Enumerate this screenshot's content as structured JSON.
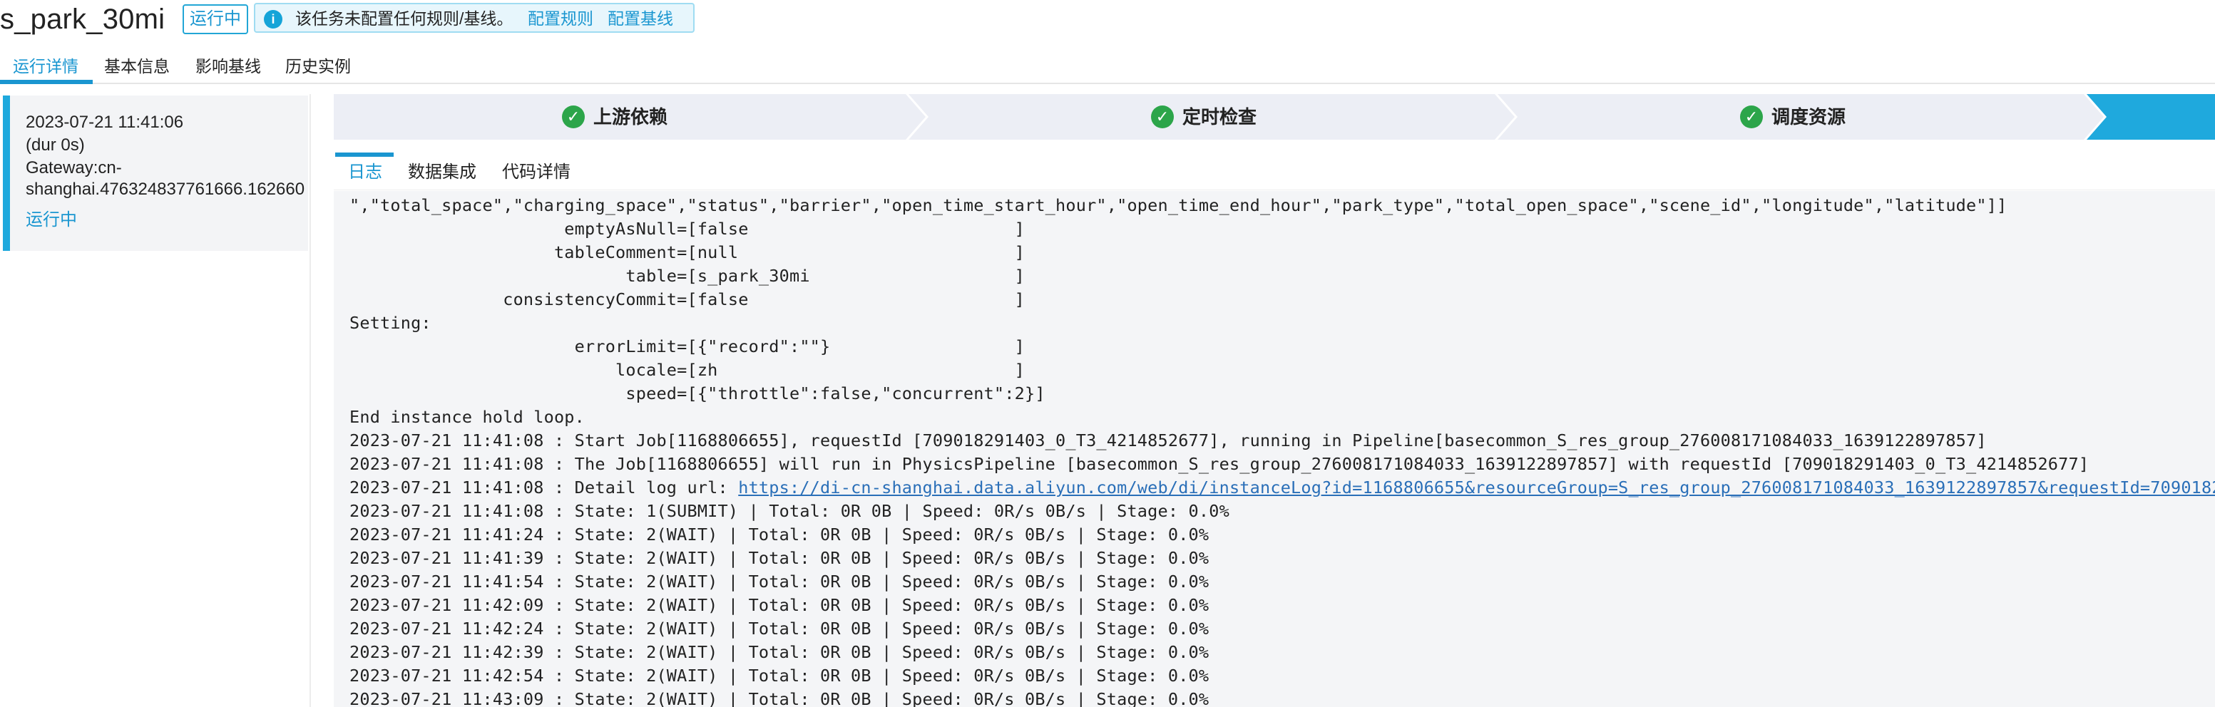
{
  "header": {
    "title": "s_park_30mi",
    "status": "运行中",
    "notice": {
      "icon": "info-icon",
      "text": "该任务未配置任何规则/基线。",
      "link_rules": "配置规则",
      "link_baseline": "配置基线"
    }
  },
  "main_tabs": [
    {
      "label": "运行详情",
      "active": true
    },
    {
      "label": "基本信息",
      "active": false
    },
    {
      "label": "影响基线",
      "active": false
    },
    {
      "label": "历史实例",
      "active": false
    }
  ],
  "instance": {
    "time": "2023-07-21 11:41:06",
    "duration": "(dur 0s)",
    "gateway_line1": "Gateway:cn-",
    "gateway_line2": "shanghai.476324837761666.162660",
    "status": "运行中"
  },
  "steps": [
    {
      "label": "上游依赖",
      "state": "done",
      "icon": "check-circle-icon"
    },
    {
      "label": "定时检查",
      "state": "done",
      "icon": "check-circle-icon"
    },
    {
      "label": "调度资源",
      "state": "done",
      "icon": "check-circle-icon"
    },
    {
      "label": "",
      "state": "active"
    }
  ],
  "sub_tabs": [
    {
      "label": "日志",
      "active": true
    },
    {
      "label": "数据集成",
      "active": false
    },
    {
      "label": "代码详情",
      "active": false
    }
  ],
  "log": {
    "lines": [
      "\",\"total_space\",\"charging_space\",\"status\",\"barrier\",\"open_time_start_hour\",\"open_time_end_hour\",\"park_type\",\"total_open_space\",\"scene_id\",\"longitude\",\"latitude\"]]",
      "                     emptyAsNull=[false                          ]",
      "                    tableComment=[null                           ]",
      "                           table=[s_park_30mi                    ]",
      "               consistencyCommit=[false                          ]",
      "Setting:",
      "                      errorLimit=[{\"record\":\"\"}                  ]",
      "                          locale=[zh                             ]",
      "                           speed=[{\"throttle\":false,\"concurrent\":2}]",
      "End instance hold loop.",
      "2023-07-21 11:41:08 : Start Job[1168806655], requestId [709018291403_0_T3_4214852677], running in Pipeline[basecommon_S_res_group_276008171084033_1639122897857]",
      "2023-07-21 11:41:08 : The Job[1168806655] will run in PhysicsPipeline [basecommon_S_res_group_276008171084033_1639122897857] with requestId [709018291403_0_T3_4214852677]",
      "2023-07-21 11:41:08 : State: 1(SUBMIT) | Total: 0R 0B | Speed: 0R/s 0B/s | Stage: 0.0%",
      "2023-07-21 11:41:24 : State: 2(WAIT) | Total: 0R 0B | Speed: 0R/s 0B/s | Stage: 0.0%",
      "2023-07-21 11:41:39 : State: 2(WAIT) | Total: 0R 0B | Speed: 0R/s 0B/s | Stage: 0.0%",
      "2023-07-21 11:41:54 : State: 2(WAIT) | Total: 0R 0B | Speed: 0R/s 0B/s | Stage: 0.0%",
      "2023-07-21 11:42:09 : State: 2(WAIT) | Total: 0R 0B | Speed: 0R/s 0B/s | Stage: 0.0%",
      "2023-07-21 11:42:24 : State: 2(WAIT) | Total: 0R 0B | Speed: 0R/s 0B/s | Stage: 0.0%",
      "2023-07-21 11:42:39 : State: 2(WAIT) | Total: 0R 0B | Speed: 0R/s 0B/s | Stage: 0.0%",
      "2023-07-21 11:42:54 : State: 2(WAIT) | Total: 0R 0B | Speed: 0R/s 0B/s | Stage: 0.0%",
      "2023-07-21 11:43:09 : State: 2(WAIT) | Total: 0R 0B | Speed: 0R/s 0B/s | Stage: 0.0%"
    ],
    "detail_prefix": "2023-07-21 11:41:08 : Detail log url: ",
    "detail_url": "https://di-cn-shanghai.data.aliyun.com/web/di/instanceLog?id=1168806655&resourceGroup=S_res_group_276008171084033_1639122897857&requestId=709018291403_0_T3_4214852677"
  },
  "colors": {
    "accent": "#1a96d0",
    "success": "#2ca54a",
    "active_step": "#1fa9dd",
    "step_bg": "#eceef5",
    "log_bg": "#f4f5f7"
  }
}
